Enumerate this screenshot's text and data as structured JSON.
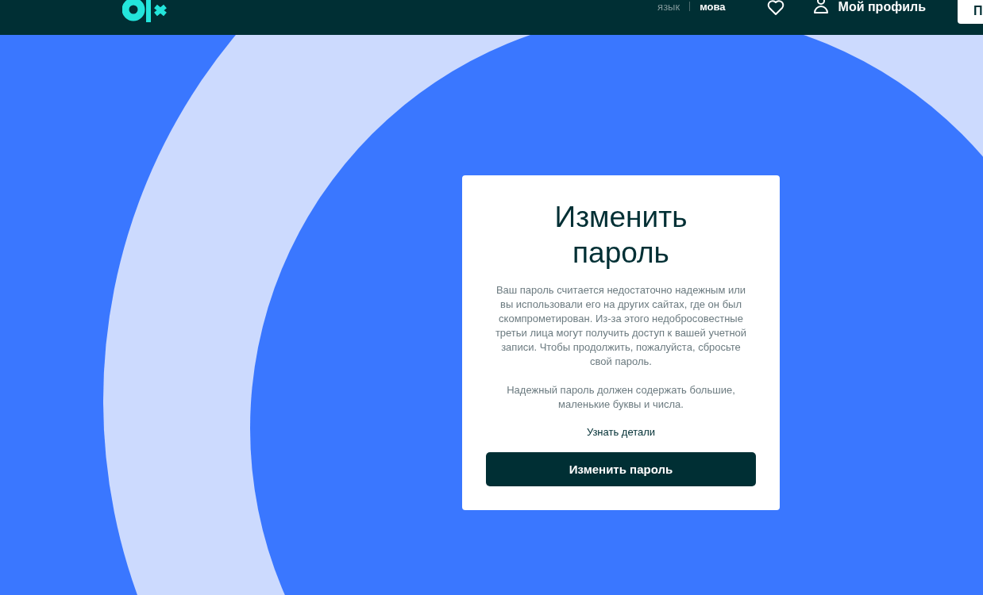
{
  "header": {
    "languages": [
      {
        "label": "язык",
        "selected": false
      },
      {
        "label": "мова",
        "selected": true
      }
    ],
    "profile": "Мой профиль",
    "post_button": "П"
  },
  "card": {
    "title": "Изменить пароль",
    "paragraphs": [
      "Ваш пароль считается недостаточно надежным или вы использовали его на других сайтах, где он был скомпрометирован. Из-за этого недобросовестные третьи лица могут получить доступ к вашей учетной записи. Чтобы продолжить, пожалуйста, сбросьте свой пароль.",
      "Надежный пароль должен содержать большие, маленькие буквы и числа."
    ],
    "link": "Узнать детали",
    "button": "Изменить пароль"
  }
}
